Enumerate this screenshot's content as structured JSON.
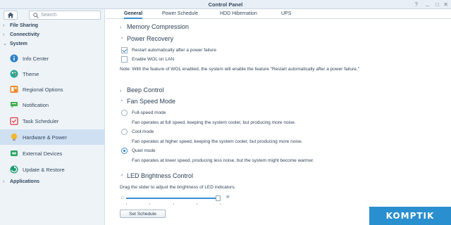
{
  "window": {
    "title": "Control Panel"
  },
  "search": {
    "placeholder": "Search"
  },
  "sidebar": {
    "groups": [
      {
        "label": "File Sharing"
      },
      {
        "label": "Connectivity"
      },
      {
        "label": "System"
      },
      {
        "label": "Applications"
      }
    ],
    "items": [
      {
        "label": "Info Center",
        "icon": "info-icon"
      },
      {
        "label": "Theme",
        "icon": "theme-icon"
      },
      {
        "label": "Regional Options",
        "icon": "regional-options-icon"
      },
      {
        "label": "Notification",
        "icon": "notification-icon"
      },
      {
        "label": "Task Scheduler",
        "icon": "task-scheduler-icon"
      },
      {
        "label": "Hardware & Power",
        "icon": "hardware-power-icon",
        "active": true
      },
      {
        "label": "External Devices",
        "icon": "external-devices-icon"
      },
      {
        "label": "Update & Restore",
        "icon": "update-restore-icon"
      }
    ]
  },
  "tabs": [
    {
      "label": "General",
      "active": true
    },
    {
      "label": "Power Schedule"
    },
    {
      "label": "HDD Hibernation"
    },
    {
      "label": "UPS"
    }
  ],
  "sections": {
    "memory_compression": "Memory Compression",
    "power_recovery": "Power Recovery",
    "beep_control": "Beep Control",
    "fan_speed_mode": "Fan Speed Mode",
    "led_brightness": "LED Brightness Control"
  },
  "power_recovery": {
    "restart_label": "Restart automatically after a power failure",
    "restart_checked": true,
    "wol_label": "Enable WOL on LAN",
    "wol_checked": false,
    "note": "Note: With the feature of WOL enabled, the system will enable the feature \"Restart automatically after a power failure.\""
  },
  "fan_speed": {
    "options": [
      {
        "label": "Full-speed mode",
        "desc": "Fan operates at full speed, keeping the system cooler, but producing more noise.",
        "selected": false
      },
      {
        "label": "Cool mode",
        "desc": "Fan operates at higher speed, keeping the system cooler, but producing more noise.",
        "selected": false
      },
      {
        "label": "Quiet mode",
        "desc": "Fan operates at lower speed, producing less noise, but the system might become warmer.",
        "selected": true
      }
    ]
  },
  "led": {
    "instruction": "Drag the slider to adjust the brightness of LED indicators.",
    "level": 1.0,
    "button_label": "Set Schedule"
  },
  "watermark": {
    "text": "KOMPTIK"
  },
  "colors": {
    "accent": "#3a8ed3",
    "active_item_bg": "#cfe0f2",
    "watermark_bg": "#2a8fcf"
  }
}
